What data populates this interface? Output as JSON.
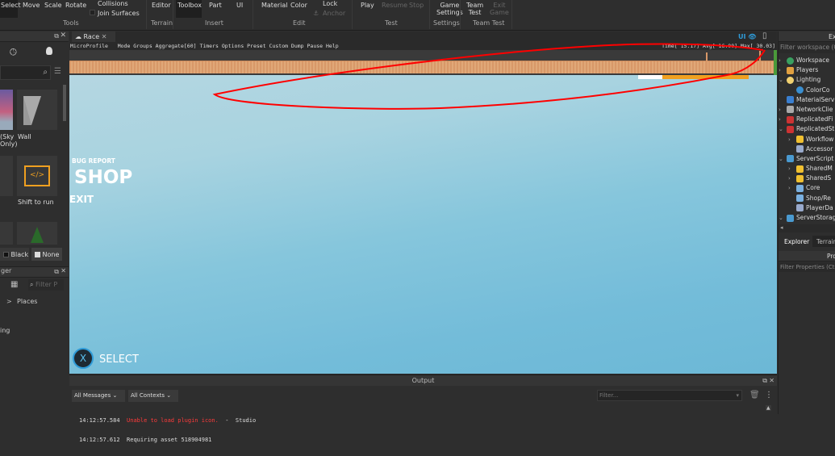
{
  "ribbon": {
    "tools": [
      "Select",
      "Move",
      "Scale",
      "Rotate"
    ],
    "collisions": "Collisions",
    "join_surfaces": "Join Surfaces",
    "editor": "Editor",
    "toolbox": "Toolbox",
    "part": "Part",
    "ui": "UI",
    "material": "Material",
    "color": "Color",
    "lock": "Lock",
    "anchor": "Anchor",
    "play": "Play",
    "resume": "Resume",
    "stop": "Stop",
    "game_settings_1": "Game",
    "game_settings_2": "Settings",
    "team_test_1": "Team",
    "team_test_2": "Test",
    "exit_game_1": "Exit",
    "exit_game_2": "Game",
    "groups": {
      "tools": "Tools",
      "terrain": "Terrain",
      "insert": "Insert",
      "edit": "Edit",
      "test": "Test",
      "settings": "Settings",
      "team_test": "Team Test"
    }
  },
  "toolbox": {
    "items": [
      {
        "label": "(Sky\nOnly)"
      },
      {
        "label": "Wall"
      },
      {
        "label": "Shift to run"
      }
    ],
    "sky_label_1": "(Sky",
    "sky_label_2": "Only)",
    "bg_black": "Black",
    "bg_none": "None"
  },
  "asset_manager": {
    "title_fragment": "ger",
    "filter_placeholder": "Filter P",
    "breadcrumb_sep": ">",
    "breadcrumb": "Places",
    "item_fragment": "ing"
  },
  "tab": {
    "name": "Race"
  },
  "microprofile": {
    "menu": "MicroProfile   Mode Groups Aggregate[60] Timers Options Preset Custom Dump Pause Help",
    "stats": "Time[ 15.17] Avg[ 16.00] Max[ 30.03]"
  },
  "viewport": {
    "ui_toggle": "UI",
    "bug_report": "BUG REPORT",
    "shop": "SHOP",
    "exit": "EXIT",
    "select_key": "X",
    "select": "SELECT"
  },
  "explorer": {
    "title": "Ex",
    "filter_placeholder": "Filter workspace (Ctrl",
    "items": [
      "Workspace",
      "Players",
      "Lighting",
      "ColorCo",
      "MaterialServ",
      "NetworkClie",
      "ReplicatedFi",
      "ReplicatedSt",
      "Workflow",
      "Accessor",
      "ServerScript",
      "SharedM",
      "SharedS",
      "Core",
      "Shop/Re",
      "PlayerDa",
      "ServerStorag"
    ],
    "tabs": [
      "Explorer",
      "Terrain"
    ]
  },
  "properties": {
    "title": "Pro",
    "filter_placeholder": "Filter Properties (Ctrl"
  },
  "output": {
    "title": "Output",
    "messages_filter": "All Messages",
    "contexts_filter": "All Contexts",
    "filter_placeholder": "Filter...",
    "lines": [
      {
        "time": "14:12:57.584",
        "text": "Unable to load plugin icon.",
        "source": "-  Studio"
      },
      {
        "time": "14:12:57.612",
        "text": "Requiring asset 518904981",
        "source": ""
      }
    ]
  },
  "colors": {
    "error": "#ff3b3b",
    "accent": "#2f9bd8",
    "annotation": "#ff0000"
  }
}
